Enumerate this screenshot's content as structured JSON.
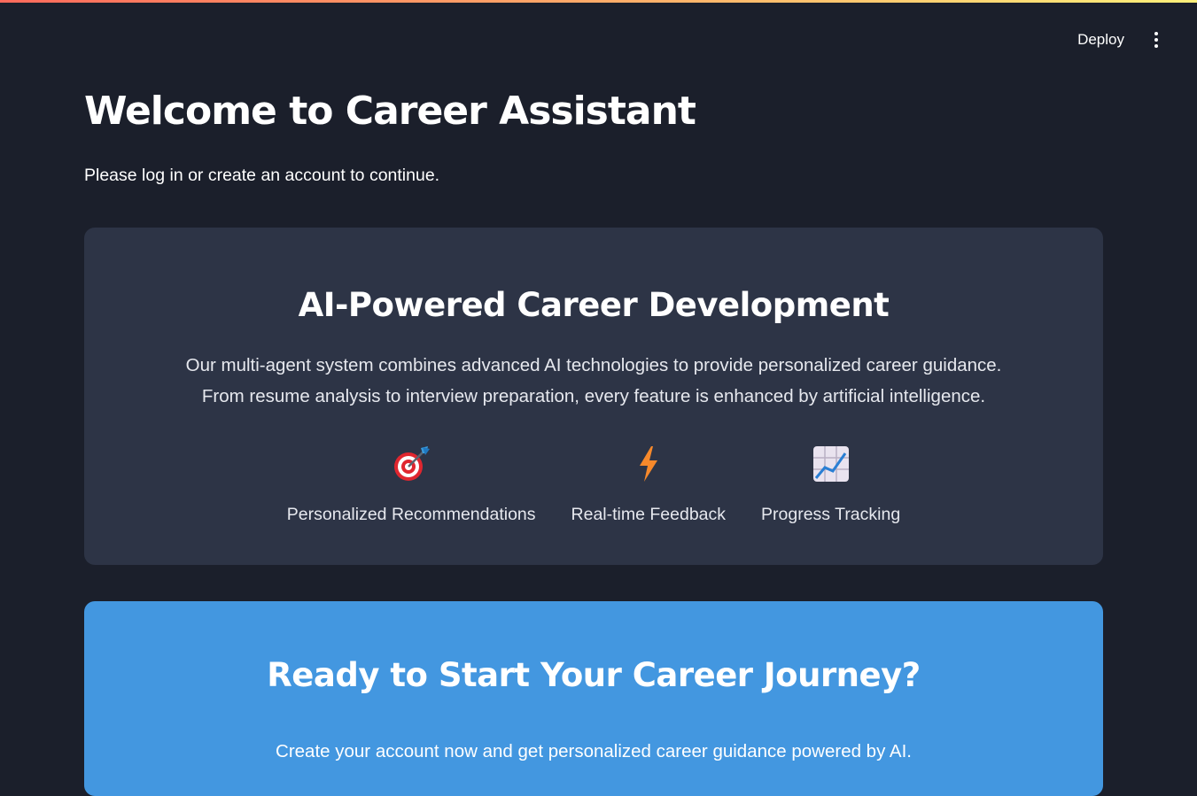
{
  "header": {
    "deploy_label": "Deploy",
    "menu_icon": "kebab-menu-icon"
  },
  "page": {
    "title": "Welcome to Career Assistant",
    "subtitle": "Please log in or create an account to continue."
  },
  "feature_card": {
    "title": "AI-Powered Career Development",
    "description_line1": "Our multi-agent system combines advanced AI technologies to provide personalized career guidance.",
    "description_line2": "From resume analysis to interview preparation, every feature is enhanced by artificial intelligence.",
    "features": [
      {
        "icon": "target-icon",
        "label": "Personalized Recommendations"
      },
      {
        "icon": "lightning-icon",
        "label": "Real-time Feedback"
      },
      {
        "icon": "chart-increasing-icon",
        "label": "Progress Tracking"
      }
    ]
  },
  "cta_card": {
    "title": "Ready to Start Your Career Journey?",
    "description": "Create your account now and get personalized career guidance powered by AI."
  },
  "colors": {
    "background": "#1b1f2b",
    "card": "#2d3446",
    "cta": "#4397e0"
  }
}
